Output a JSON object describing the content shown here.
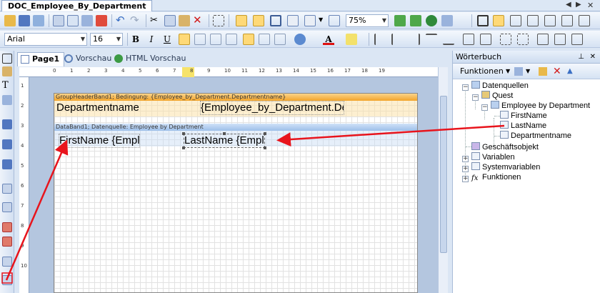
{
  "window": {
    "title": "DOC_Employee_By_Department"
  },
  "toolbar": {
    "zoom": "75%",
    "font_name": "Arial",
    "font_size": "16",
    "bold": "B",
    "italic": "I",
    "underline": "U",
    "font_color_glyph": "A"
  },
  "tabs": [
    {
      "label": "Page1"
    },
    {
      "label": "Vorschau"
    },
    {
      "label": "HTML Vorschau"
    }
  ],
  "report": {
    "header_band_title": "GroupHeaderBand1; Bedingung: {Employee_by_Department.Departmentname}",
    "header_field_1": "Departmentname",
    "header_field_2": "{Employee_by_Department.Dep",
    "data_band_title": "DataBand1; Datenquelle: Employee by Department",
    "data_field_1": "FirstName {Emplo",
    "data_field_2": "LastName {Emplo"
  },
  "ruler": {
    "top_ticks": [
      "0",
      "1",
      "2",
      "3",
      "4",
      "5",
      "6",
      "7",
      "8",
      "9",
      "10",
      "11",
      "12",
      "13",
      "14",
      "15",
      "16",
      "17",
      "18",
      "19"
    ],
    "left_ticks": [
      "1",
      "2",
      "3",
      "4",
      "5",
      "6",
      "7",
      "8",
      "9",
      "10"
    ]
  },
  "dictionary": {
    "title": "Wörterbuch",
    "functions_label": "Funktionen",
    "tree": {
      "datasources": "Datenquellen",
      "quest": "Quest",
      "employee": "Employee by Department",
      "firstname": "FirstName",
      "lastname": "LastName",
      "departmentname": "Departmentname",
      "business": "Geschäftsobjekt",
      "variables": "Variablen",
      "sysvariables": "Systemvariablen",
      "functions": "Funktionen"
    }
  },
  "colors": {
    "annotation_arrow": "#e8141c",
    "header_band": "#f3a42a",
    "data_band": "#9ebfe9"
  }
}
